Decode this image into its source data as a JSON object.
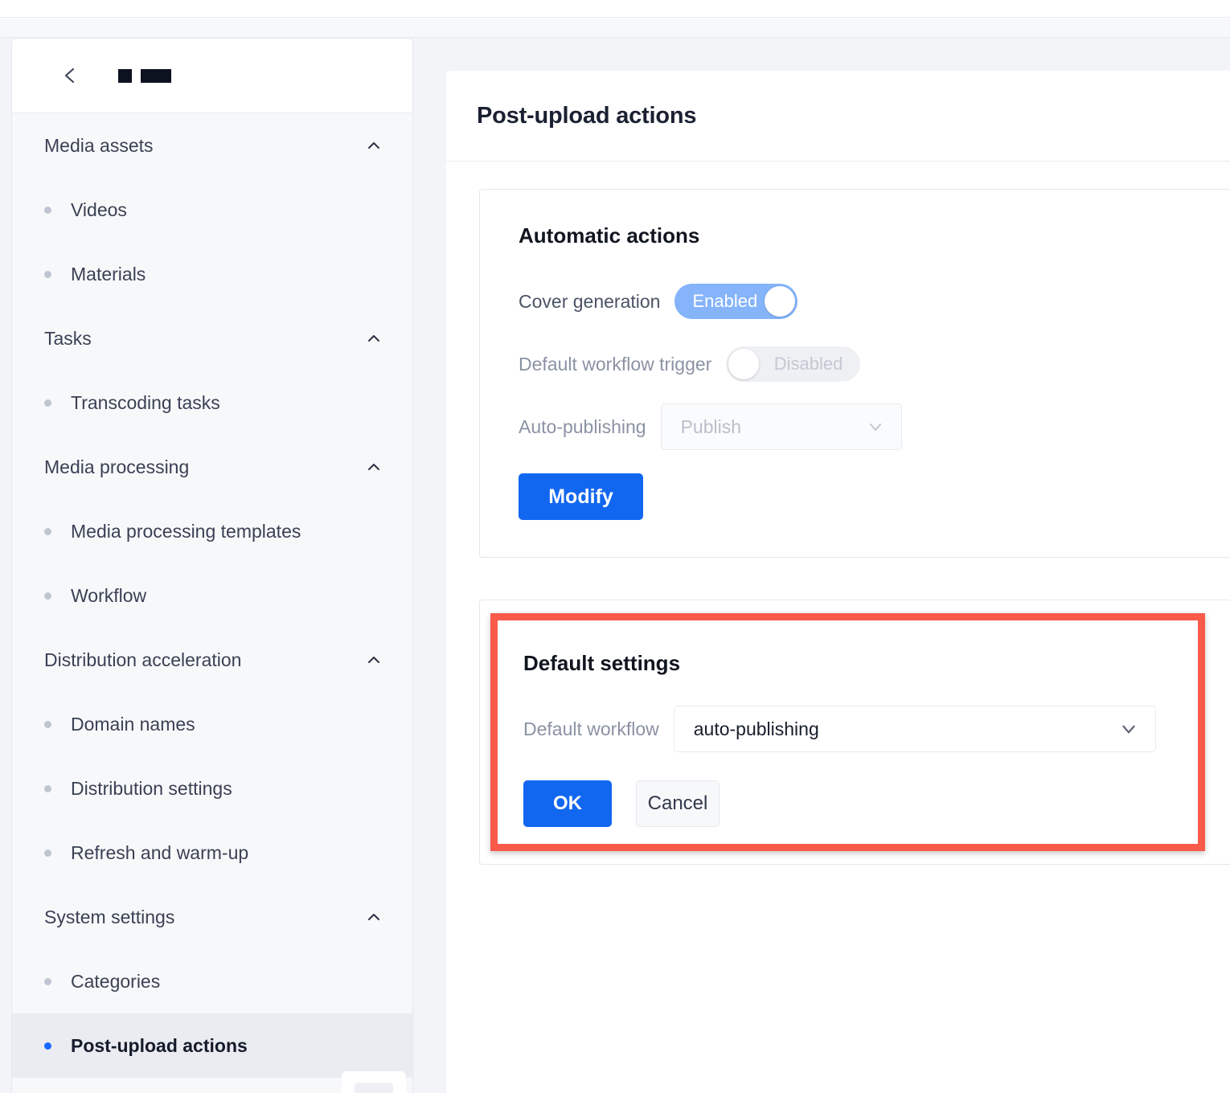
{
  "colors": {
    "accent_blue": "#1267f0",
    "toggle_on_blue": "#85b4fb",
    "highlight_red": "#fa5a4a",
    "page_bg": "#f3f4f8",
    "sidebar_bg": "#f7f8fa"
  },
  "sidebar": {
    "back_icon": "chevron-left-icon",
    "title_redacted": [
      "█",
      "███"
    ],
    "groups": [
      {
        "title": "Media assets",
        "caret": "chevron-up-icon",
        "expanded": true,
        "items": [
          {
            "label": "Videos",
            "active": false
          },
          {
            "label": "Materials",
            "active": false
          }
        ]
      },
      {
        "title": "Tasks",
        "caret": "chevron-up-icon",
        "expanded": true,
        "items": [
          {
            "label": "Transcoding tasks",
            "active": false
          }
        ]
      },
      {
        "title": "Media processing",
        "caret": "chevron-up-icon",
        "expanded": true,
        "items": [
          {
            "label": "Media processing templates",
            "active": false
          },
          {
            "label": "Workflow",
            "active": false
          }
        ]
      },
      {
        "title": "Distribution acceleration",
        "caret": "chevron-up-icon",
        "expanded": true,
        "items": [
          {
            "label": "Domain names",
            "active": false
          },
          {
            "label": "Distribution settings",
            "active": false
          },
          {
            "label": "Refresh and warm-up",
            "active": false
          }
        ]
      },
      {
        "title": "System settings",
        "caret": "chevron-up-icon",
        "expanded": true,
        "items": [
          {
            "label": "Categories",
            "active": false
          },
          {
            "label": "Post-upload actions",
            "active": true
          }
        ]
      }
    ]
  },
  "main": {
    "page_title": "Post-upload actions",
    "automatic_actions": {
      "heading": "Automatic actions",
      "cover_generation": {
        "label": "Cover generation",
        "toggle_state": "Enabled",
        "on": true
      },
      "default_workflow_trigger": {
        "label": "Default workflow trigger",
        "toggle_state": "Disabled",
        "on": false
      },
      "auto_publishing": {
        "label": "Auto-publishing",
        "value": "Publish",
        "disabled": true,
        "caret": "chevron-down-icon"
      },
      "modify_button": "Modify"
    },
    "default_settings": {
      "heading": "Default settings",
      "default_workflow": {
        "label": "Default workflow",
        "value": "auto-publishing",
        "caret": "chevron-down-icon"
      },
      "ok_button": "OK",
      "cancel_button": "Cancel"
    }
  }
}
